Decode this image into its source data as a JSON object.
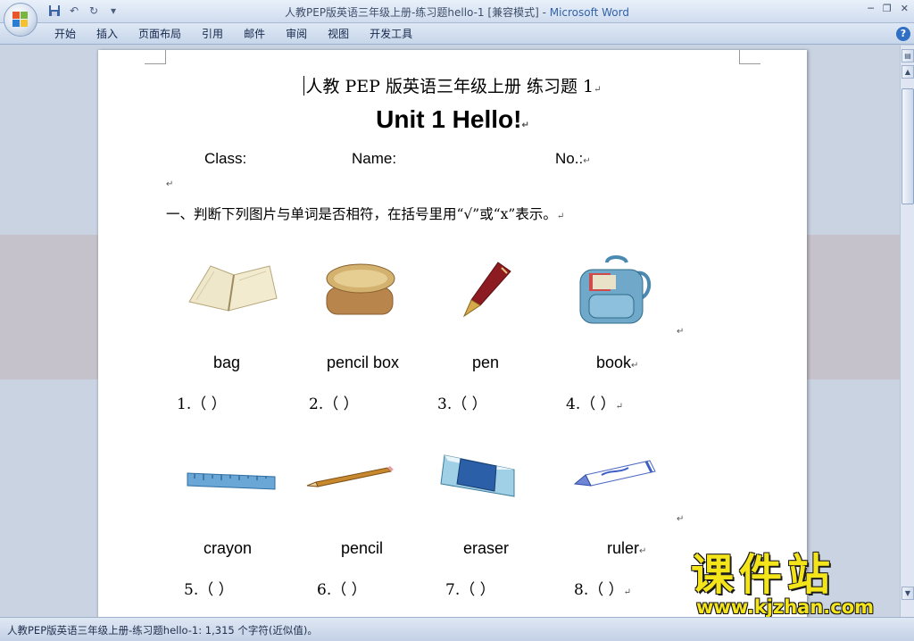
{
  "window": {
    "title": "人教PEP版英语三年级上册-练习题hello-1 [兼容模式]",
    "title_sep": " - ",
    "app_name": "Microsoft Word"
  },
  "ribbon": {
    "tabs": [
      "开始",
      "插入",
      "页面布局",
      "引用",
      "邮件",
      "审阅",
      "视图",
      "开发工具"
    ]
  },
  "icons": {
    "office_button": "office-logo-icon",
    "save": "save-icon",
    "undo": "undo-icon",
    "redo": "redo-icon",
    "customize": "qat-dropdown-icon",
    "help": "help-icon"
  },
  "document": {
    "title": "人教 PEP 版英语三年级上册  练习题 1",
    "unit_title": "Unit 1 Hello!",
    "class_label": "Class:",
    "name_label": "Name:",
    "no_label": "No.:",
    "question": "一、判断下列图片与单词是否相符，在括号里用“√”或“x”表示。",
    "paragraph_mark": "↵",
    "row1": {
      "pictures": [
        "book-picture",
        "pencil-box-picture",
        "pen-picture",
        "bag-picture"
      ],
      "words": [
        "bag",
        "pencil box",
        "pen",
        "book"
      ],
      "blanks": [
        "1.（          ）",
        "2.（          ）",
        "3.（          ）",
        "4.（          ）"
      ]
    },
    "row2": {
      "pictures": [
        "ruler-picture",
        "pencil-picture",
        "eraser-picture",
        "crayon-picture"
      ],
      "words": [
        "crayon",
        "pencil",
        "eraser",
        "ruler"
      ],
      "blanks": [
        "5.（          ）",
        "6.（          ）",
        "7.（          ）",
        "8.（          ）"
      ]
    }
  },
  "status": {
    "text": "人教PEP版英语三年级上册-练习题hello-1: 1,315 个字符(近似值)。"
  },
  "watermark": {
    "chinese": "课件站",
    "url": "www.kjzhan.com"
  },
  "colors": {
    "ribbon": "#dfe8f5",
    "app_name": "#3262a8",
    "watermark": "#f4e41a",
    "workspace": "#c9d3e2"
  }
}
